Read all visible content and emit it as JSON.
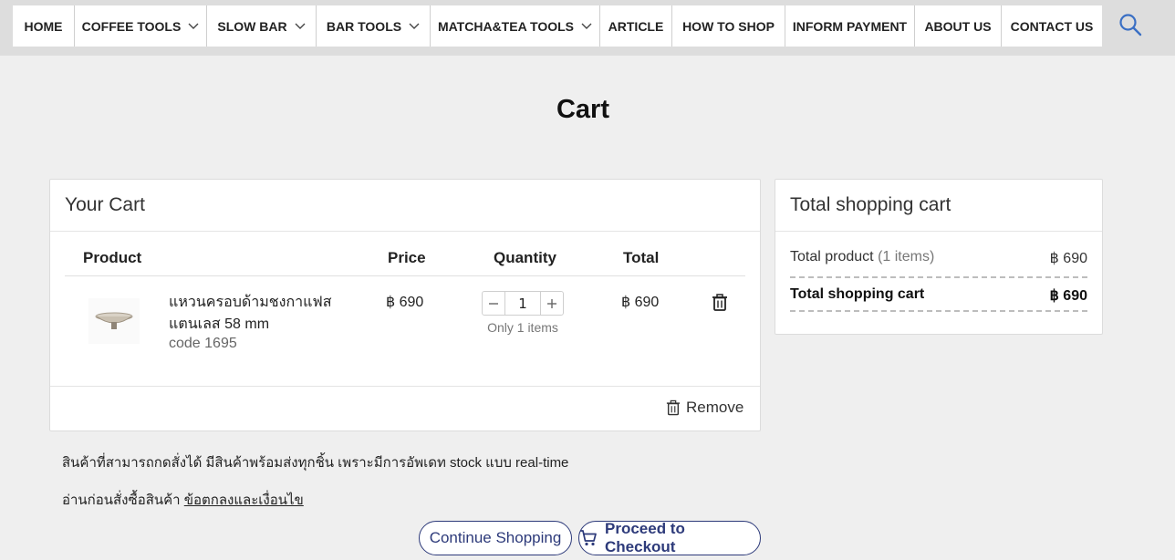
{
  "nav": {
    "items": [
      {
        "label": "HOME",
        "dropdown": false
      },
      {
        "label": "COFFEE TOOLS",
        "dropdown": true
      },
      {
        "label": "SLOW BAR",
        "dropdown": true
      },
      {
        "label": "BAR TOOLS",
        "dropdown": true
      },
      {
        "label": "MATCHA&TEA TOOLS",
        "dropdown": true
      },
      {
        "label": "ARTICLE",
        "dropdown": false
      },
      {
        "label": "HOW TO SHOP",
        "dropdown": false
      },
      {
        "label": "INFORM PAYMENT",
        "dropdown": false
      },
      {
        "label": "ABOUT US",
        "dropdown": false
      },
      {
        "label": "CONTACT US",
        "dropdown": false
      }
    ],
    "search_icon": "search-icon"
  },
  "page": {
    "title": "Cart"
  },
  "cart": {
    "heading": "Your Cart",
    "columns": {
      "product": "Product",
      "price": "Price",
      "quantity": "Quantity",
      "total": "Total"
    },
    "items": [
      {
        "name": "แหวนครอบด้ามชงกาแฟสแตนเลส 58 mm",
        "code": "code 1695",
        "price": "฿ 690",
        "quantity": "1",
        "qty_note": "Only 1 items",
        "total": "฿ 690"
      }
    ],
    "remove_label": "Remove"
  },
  "summary": {
    "heading": "Total shopping cart",
    "product_label": "Total product",
    "product_count": "(1 items)",
    "product_value": "฿ 690",
    "total_label": "Total shopping cart",
    "total_value": "฿ 690"
  },
  "notes": {
    "stock_note": "สินค้าที่สามารถกดสั่งได้ มีสินค้าพร้อมส่งทุกชิ้น เพราะมีการอัพเดท stock แบบ real-time",
    "terms_prefix": "อ่านก่อนสั่งซื้อสินค้า",
    "terms_link": "ข้อตกลงและเงื่อนไข"
  },
  "buttons": {
    "continue": "Continue Shopping",
    "checkout": "Proceed to Checkout"
  },
  "colors": {
    "accent": "#2d3a7a",
    "search": "#3a6fc4"
  }
}
